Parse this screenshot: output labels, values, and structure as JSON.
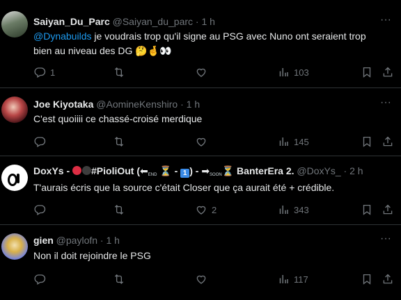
{
  "tweets": [
    {
      "name": "Saiyan_Du_Parc",
      "handle": "@Saiyan_du_parc",
      "sep": "·",
      "time": "1 h",
      "mention": "@Dynabuilds",
      "text": " je voudrais trop qu'il signe au PSG avec Nuno ont seraient trop bien au niveau des DG 🤔🤞👀",
      "replies": "1",
      "retweets": "",
      "likes": "",
      "views": "103"
    },
    {
      "name": "Joe Kiyotaka",
      "handle": "@AomineKenshiro",
      "sep": "·",
      "time": "1 h",
      "text": "C'est quoiiii ce chassé-croisé merdique",
      "replies": "",
      "retweets": "",
      "likes": "",
      "views": "145"
    },
    {
      "name_prefix": "DoxYs -",
      "hashtag": "#PioliOut (",
      "end_label": "END",
      "hourglass": "⏳",
      "dash": " - ",
      "badge_num": "1",
      "close_paren": ") -",
      "soon_label": "SOON",
      "banter": "BanterEra 2.",
      "handle": "@DoxYs_",
      "sep": "·",
      "time": "2 h",
      "text": "T'aurais écris que la source c'était Closer que ça aurait été + crédible.",
      "replies": "",
      "retweets": "",
      "likes": "2",
      "views": "343"
    },
    {
      "name": "gien",
      "handle": "@paylofn",
      "sep": "·",
      "time": "1 h",
      "text": "Non il doit rejoindre le PSG",
      "replies": "",
      "retweets": "",
      "likes": "",
      "views": "117"
    }
  ],
  "icons": {
    "more": "more-horizontal-icon",
    "reply": "reply-icon",
    "retweet": "retweet-icon",
    "like": "like-icon",
    "views": "views-icon",
    "bookmark": "bookmark-icon",
    "share": "share-icon"
  },
  "colors": {
    "background": "#000000",
    "text": "#e7e9ea",
    "muted": "#71767b",
    "link": "#1d9bf0",
    "divider": "#2f3336"
  }
}
